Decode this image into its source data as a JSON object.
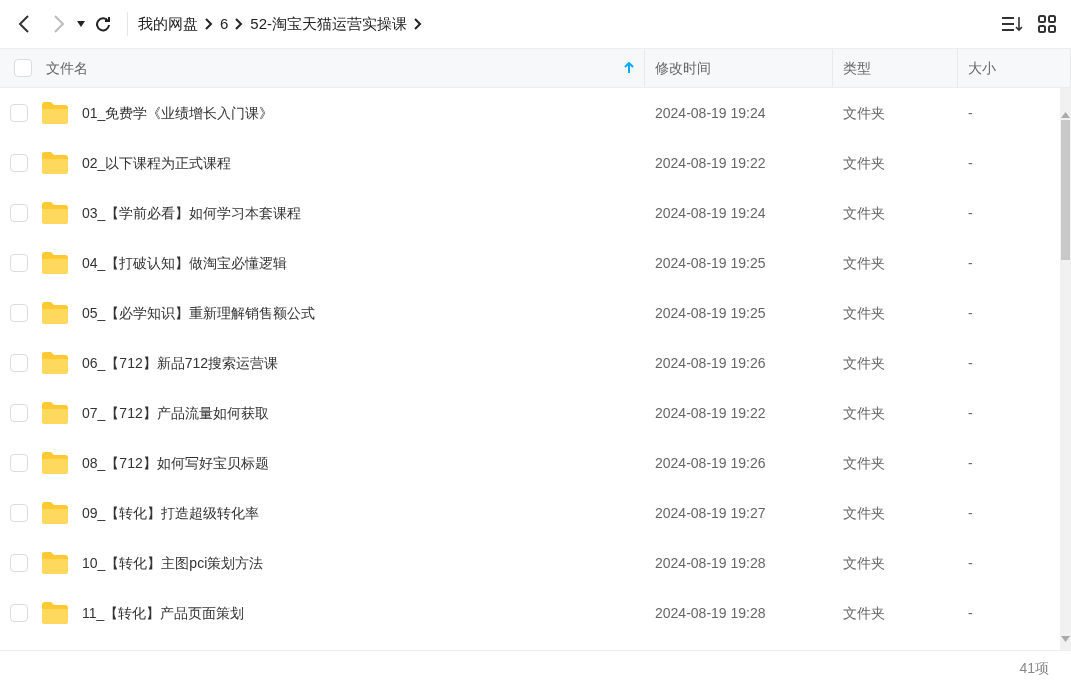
{
  "toolbar": {
    "back": {
      "disabled": false
    },
    "forward": {
      "disabled": true
    },
    "breadcrumb": [
      "我的网盘",
      "6",
      "52-淘宝天猫运营实操课"
    ]
  },
  "table": {
    "select_all": {
      "checked": false
    },
    "columns": [
      {
        "label": "文件名",
        "sorted": true
      },
      {
        "label": "修改时间",
        "sorted": false
      },
      {
        "label": "类型",
        "sorted": false
      },
      {
        "label": "大小",
        "sorted": false
      }
    ],
    "rows": [
      {
        "checked": false,
        "name": "01_免费学《业绩增长入门课》",
        "modified": "2024-08-19 19:24",
        "type": "文件夹",
        "size": "-"
      },
      {
        "checked": false,
        "name": "02_以下课程为正式课程",
        "modified": "2024-08-19 19:22",
        "type": "文件夹",
        "size": "-"
      },
      {
        "checked": false,
        "name": "03_【学前必看】如何学习本套课程",
        "modified": "2024-08-19 19:24",
        "type": "文件夹",
        "size": "-"
      },
      {
        "checked": false,
        "name": "04_【打破认知】做淘宝必懂逻辑",
        "modified": "2024-08-19 19:25",
        "type": "文件夹",
        "size": "-"
      },
      {
        "checked": false,
        "name": "05_【必学知识】重新理解销售额公式",
        "modified": "2024-08-19 19:25",
        "type": "文件夹",
        "size": "-"
      },
      {
        "checked": false,
        "name": "06_【712】新品712搜索运营课",
        "modified": "2024-08-19 19:26",
        "type": "文件夹",
        "size": "-"
      },
      {
        "checked": false,
        "name": "07_【712】产品流量如何获取",
        "modified": "2024-08-19 19:22",
        "type": "文件夹",
        "size": "-"
      },
      {
        "checked": false,
        "name": "08_【712】如何写好宝贝标题",
        "modified": "2024-08-19 19:26",
        "type": "文件夹",
        "size": "-"
      },
      {
        "checked": false,
        "name": "09_【转化】打造超级转化率",
        "modified": "2024-08-19 19:27",
        "type": "文件夹",
        "size": "-"
      },
      {
        "checked": false,
        "name": "10_【转化】主图pci策划方法",
        "modified": "2024-08-19 19:28",
        "type": "文件夹",
        "size": "-"
      },
      {
        "checked": false,
        "name": "11_【转化】产品页面策划",
        "modified": "2024-08-19 19:28",
        "type": "文件夹",
        "size": "-"
      }
    ]
  },
  "status_bar": {
    "count": "41项"
  }
}
